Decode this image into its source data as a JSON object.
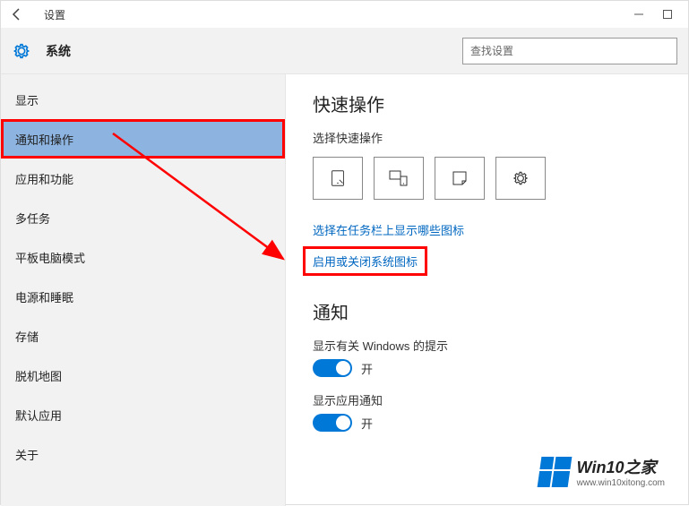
{
  "window": {
    "title": "设置",
    "section": "系统"
  },
  "search": {
    "placeholder": "查找设置"
  },
  "sidebar": {
    "items": [
      {
        "label": "显示"
      },
      {
        "label": "通知和操作"
      },
      {
        "label": "应用和功能"
      },
      {
        "label": "多任务"
      },
      {
        "label": "平板电脑模式"
      },
      {
        "label": "电源和睡眠"
      },
      {
        "label": "存储"
      },
      {
        "label": "脱机地图"
      },
      {
        "label": "默认应用"
      },
      {
        "label": "关于"
      }
    ],
    "selected_index": 1
  },
  "content": {
    "quick_actions_heading": "快速操作",
    "quick_actions_subtitle": "选择快速操作",
    "link_taskbar_icons": "选择在任务栏上显示哪些图标",
    "link_system_icons": "启用或关闭系统图标",
    "notifications_heading": "通知",
    "option1_label": "显示有关 Windows 的提示",
    "option1_state": "开",
    "option2_label": "显示应用通知",
    "option2_state": "开"
  },
  "watermark": {
    "brand": "Win10之家",
    "url": "www.win10xitong.com"
  }
}
